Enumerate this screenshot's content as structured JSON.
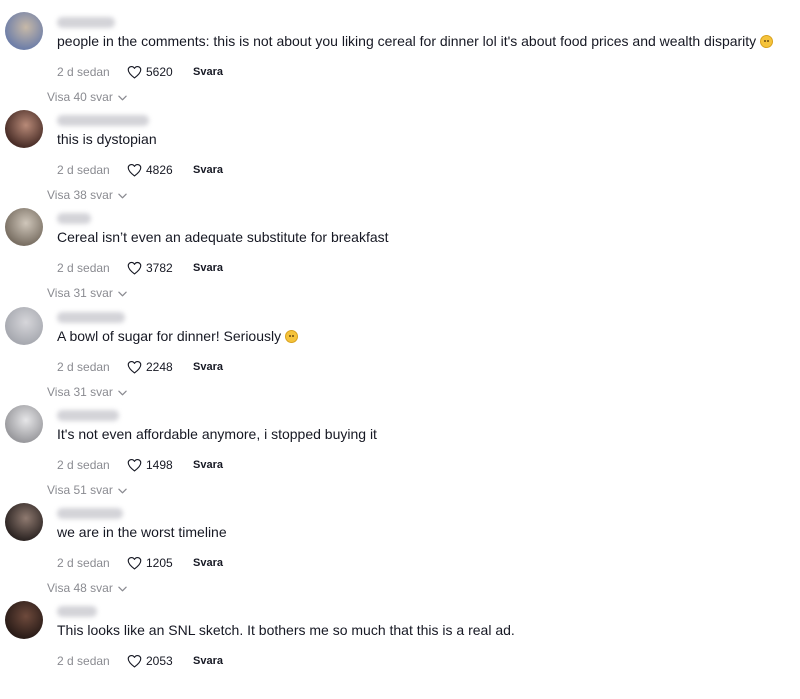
{
  "comments": [
    {
      "username": "Honeybeam",
      "text": "people in the comments: this is not about you liking cereal for dinner lol it's about food prices and wealth disparity",
      "emoji": "disappointed-face",
      "time": "2 d sedan",
      "likes": "5620",
      "reply_label": "Svara",
      "view_replies": "Visa 40 svar",
      "avatar_colors": [
        "#6f7fa8",
        "#c7b9a8"
      ]
    },
    {
      "username": "Crumbatraitoadekhah",
      "text": "this is dystopian",
      "emoji": "",
      "time": "2 d sedan",
      "likes": "4826",
      "reply_label": "Svara",
      "view_replies": "Visa 38 svar",
      "avatar_colors": [
        "#4a2e28",
        "#b88a78"
      ]
    },
    {
      "username": "Kindle",
      "text": "Cereal isn’t even an adequate substitute for breakfast",
      "emoji": "",
      "time": "2 d sedan",
      "likes": "3782",
      "reply_label": "Svara",
      "view_replies": "Visa 31 svar",
      "avatar_colors": [
        "#7a7064",
        "#cfc6ba"
      ]
    },
    {
      "username": "sandmanilO",
      "text": "A bowl of sugar for dinner! Seriously",
      "emoji": "grimacing-face",
      "time": "2 d sedan",
      "likes": "2248",
      "reply_label": "Svara",
      "view_replies": "Visa 31 svar",
      "avatar_colors": [
        "#a7a9b0",
        "#d6d6da"
      ]
    },
    {
      "username": "AConfirmDay",
      "text": "It's not even affordable anymore, i stopped buying it",
      "emoji": "",
      "time": "2 d sedan",
      "likes": "1498",
      "reply_label": "Svara",
      "view_replies": "Visa 51 svar",
      "avatar_colors": [
        "#9a9a9e",
        "#e6e6e8"
      ]
    },
    {
      "username": "Br Whimpsy",
      "text": "we are in the worst timeline",
      "emoji": "",
      "time": "2 d sedan",
      "likes": "1205",
      "reply_label": "Svara",
      "view_replies": "Visa 48 svar",
      "avatar_colors": [
        "#2e2624",
        "#8f7a70"
      ]
    },
    {
      "username": "Edgar S",
      "text": "This looks like an SNL sketch. It bothers me so much that this is a real ad.",
      "emoji": "",
      "time": "2 d sedan",
      "likes": "2053",
      "reply_label": "Svara",
      "view_replies": "",
      "avatar_colors": [
        "#2a1c18",
        "#6e4a3c"
      ]
    }
  ],
  "icons": {
    "like": "heart-outline-icon",
    "expand": "chevron-down-icon"
  },
  "colors": {
    "text": "#161823",
    "secondary": "#8a8b91"
  }
}
